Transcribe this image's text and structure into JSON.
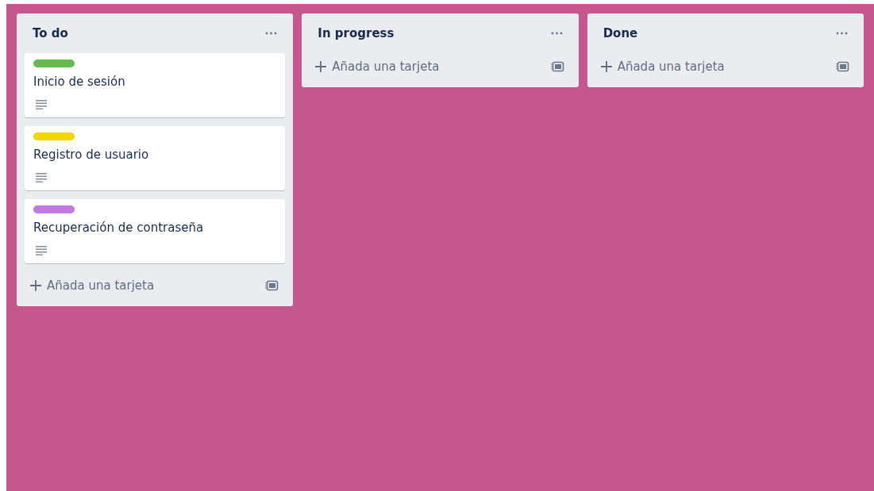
{
  "lists": [
    {
      "title": "To do",
      "cards": [
        {
          "color": "#61bd4f",
          "title": "Inicio de sesión",
          "has_description": true
        },
        {
          "color": "#f2d600",
          "title": "Registro de usuario",
          "has_description": true
        },
        {
          "color": "#c377e0",
          "title": "Recuperación de contraseña",
          "has_description": true
        }
      ],
      "add_label": "Añada una tarjeta"
    },
    {
      "title": "In progress",
      "add_label": "Añada una tarjeta"
    },
    {
      "title": "Done",
      "add_label": "Añada una tarjeta"
    }
  ]
}
